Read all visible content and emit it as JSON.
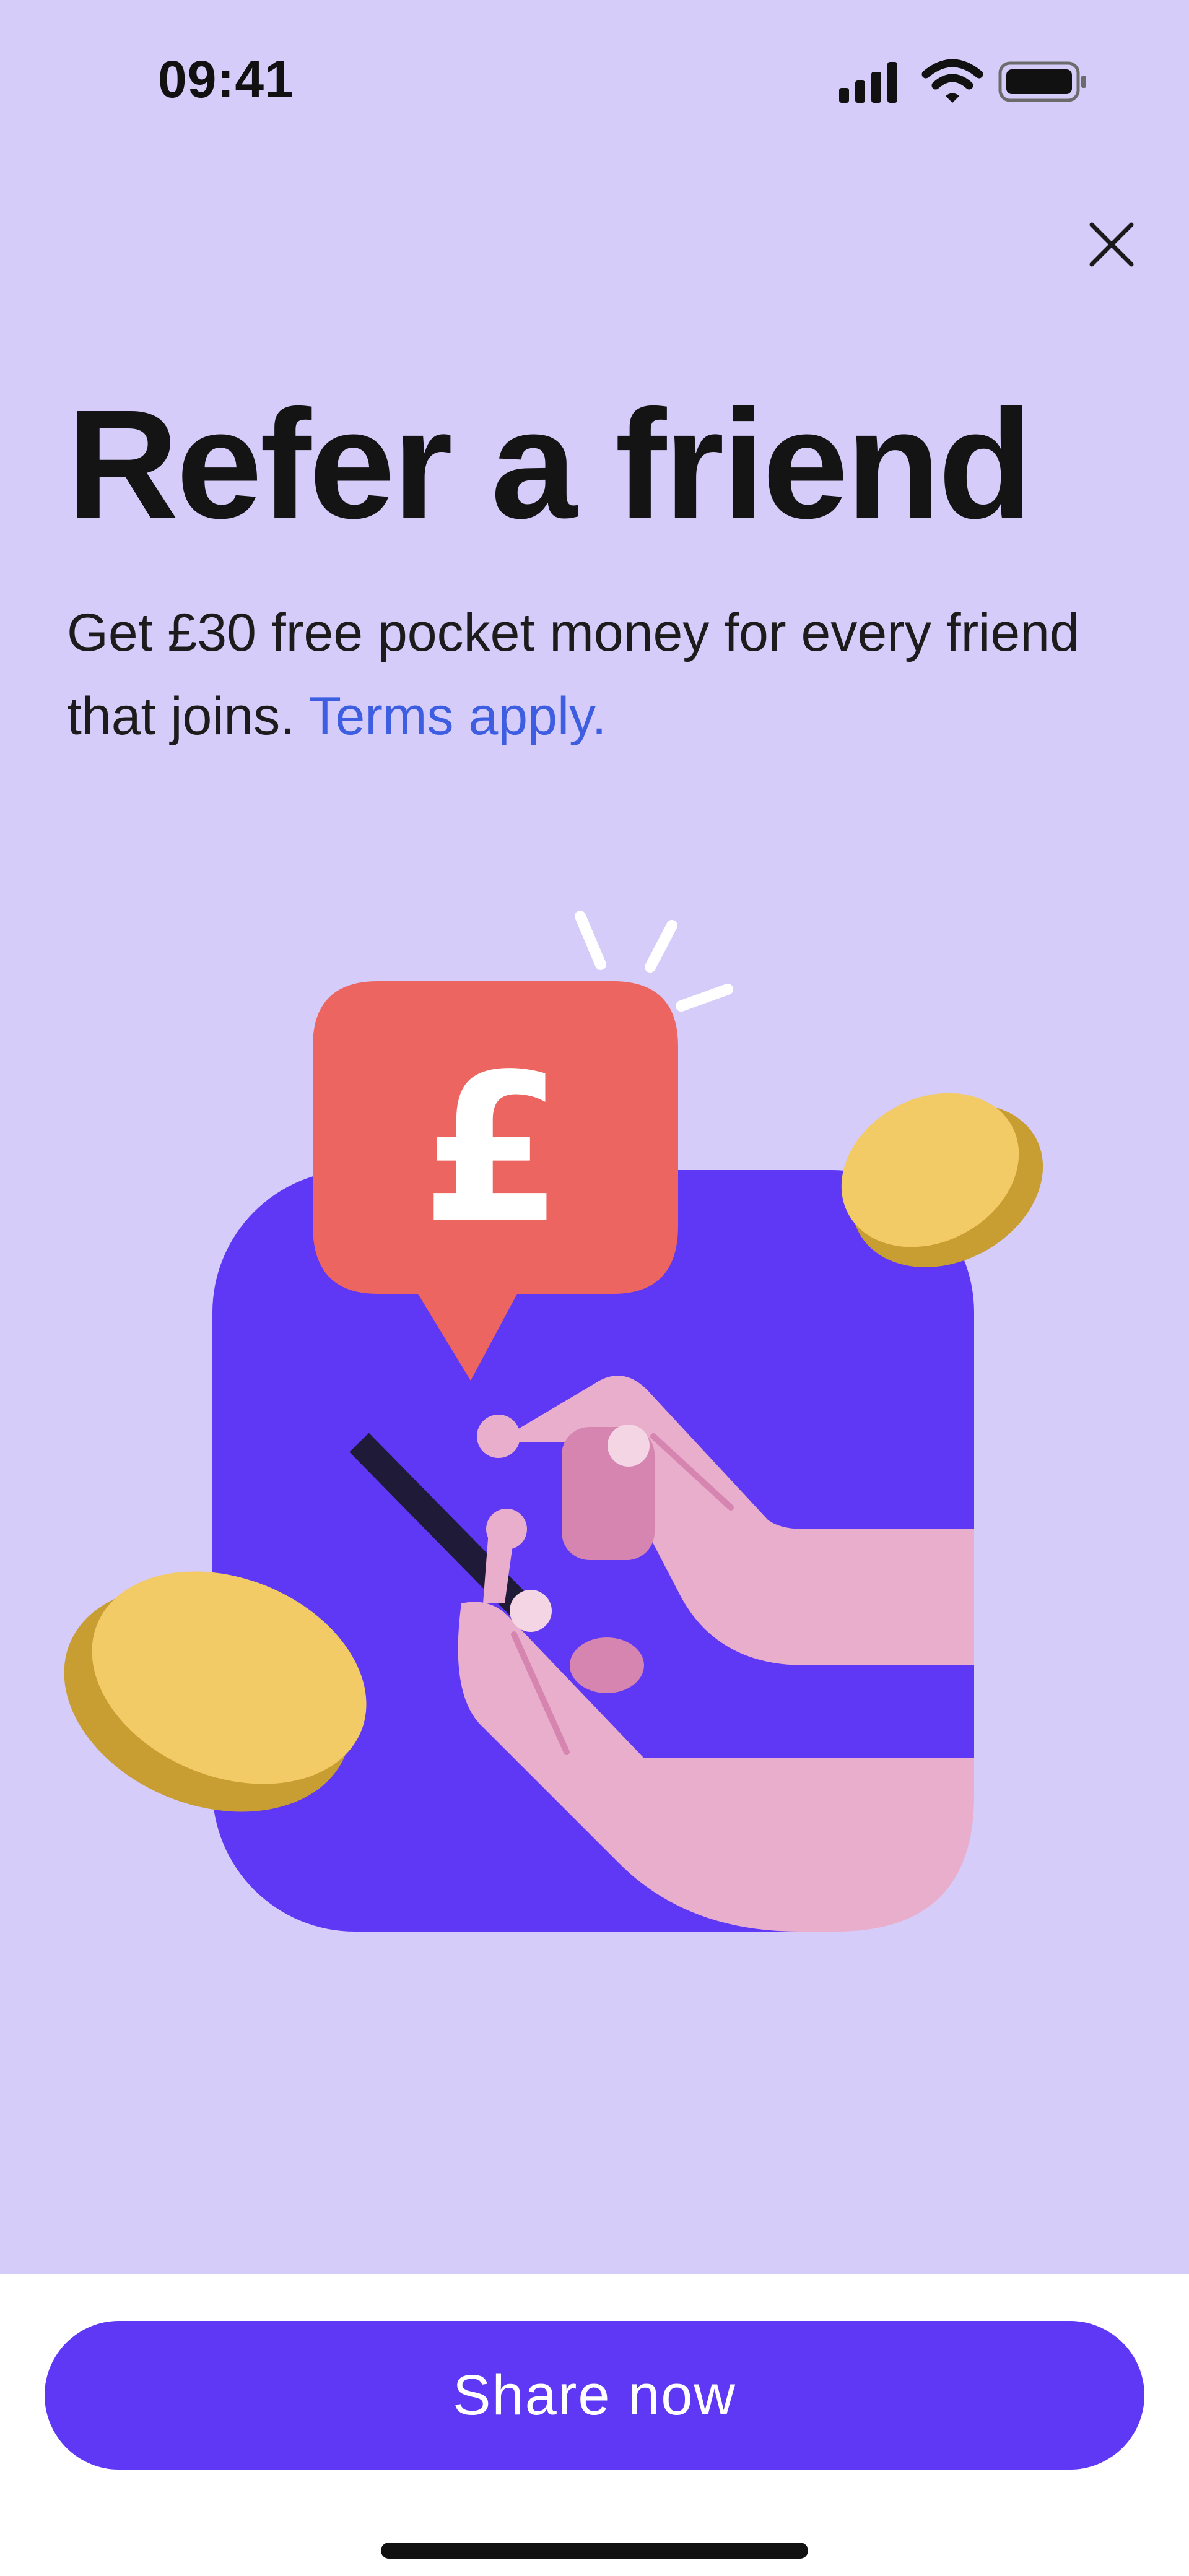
{
  "status_bar": {
    "time": "09:41",
    "icons": [
      "signal-icon",
      "wifi-icon",
      "battery-icon"
    ]
  },
  "header": {
    "close_icon": "close-icon"
  },
  "content": {
    "title": "Refer a friend",
    "description": "Get £30 free pocket money for every friend that joins.",
    "terms_link": "Terms apply."
  },
  "illustration": {
    "currency_symbol": "£"
  },
  "footer": {
    "share_button_label": "Share now"
  },
  "colors": {
    "background": "#D5CCFA",
    "accent": "#5E38F4",
    "link": "#3D5EE0",
    "speech_bubble": "#EC6560",
    "coin": "#F2CA66",
    "hand": "#E9AECB"
  }
}
